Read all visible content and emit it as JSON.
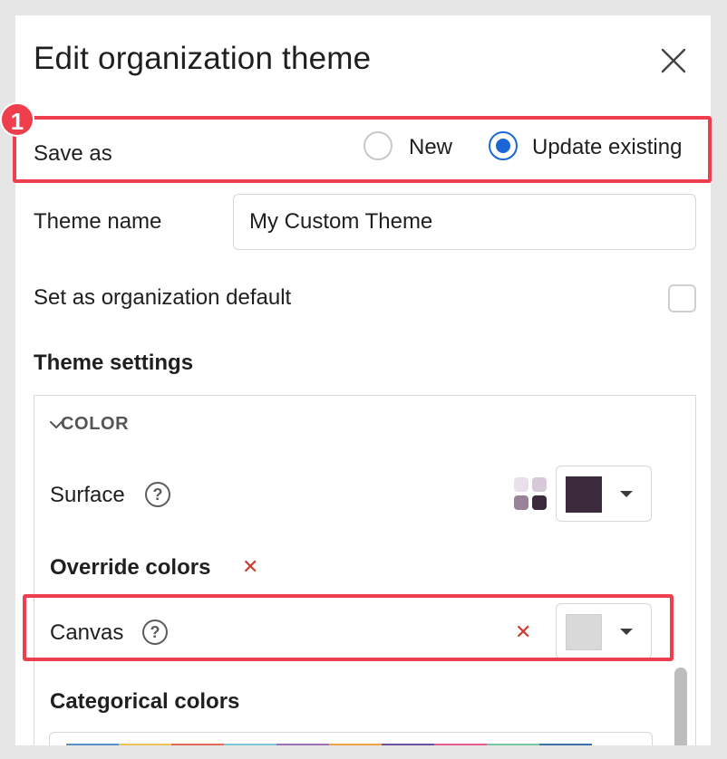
{
  "dialog": {
    "title": "Edit organization theme",
    "close_icon": "close-icon"
  },
  "step_badge": "1",
  "save_as": {
    "label": "Save as",
    "options": [
      {
        "label": "New",
        "selected": false
      },
      {
        "label": "Update existing",
        "selected": true
      }
    ]
  },
  "theme_name": {
    "label": "Theme name",
    "value": "My Custom Theme"
  },
  "org_default": {
    "label": "Set as organization default",
    "checked": false
  },
  "theme_settings": {
    "title": "Theme settings",
    "color_section": "COLOR",
    "surface": {
      "label": "Surface",
      "help_icon": "question-circle-icon",
      "palette_colors": [
        "#e9e0ea",
        "#d7c9da",
        "#9a8399",
        "#3b2a3b"
      ],
      "selected_color": "#3b2a3b"
    },
    "override_colors": {
      "title": "Override colors",
      "clear_icon": "close-x-icon"
    },
    "canvas": {
      "label": "Canvas",
      "help_icon": "question-circle-icon",
      "selected_color": "#d9d9d9"
    },
    "categorical_colors": {
      "title": "Categorical colors",
      "colors": [
        "#5b8fc9",
        "#f0c35a",
        "#e06b5a",
        "#7cc6d6",
        "#9c6fb8",
        "#f2a14b",
        "#6b4fa1",
        "#e45b8c",
        "#78c8a2",
        "#3f6fa8"
      ]
    }
  },
  "colors": {
    "accent": "#1a66d6",
    "highlight": "#ef3e4e",
    "danger_x": "#cf3b2b"
  }
}
